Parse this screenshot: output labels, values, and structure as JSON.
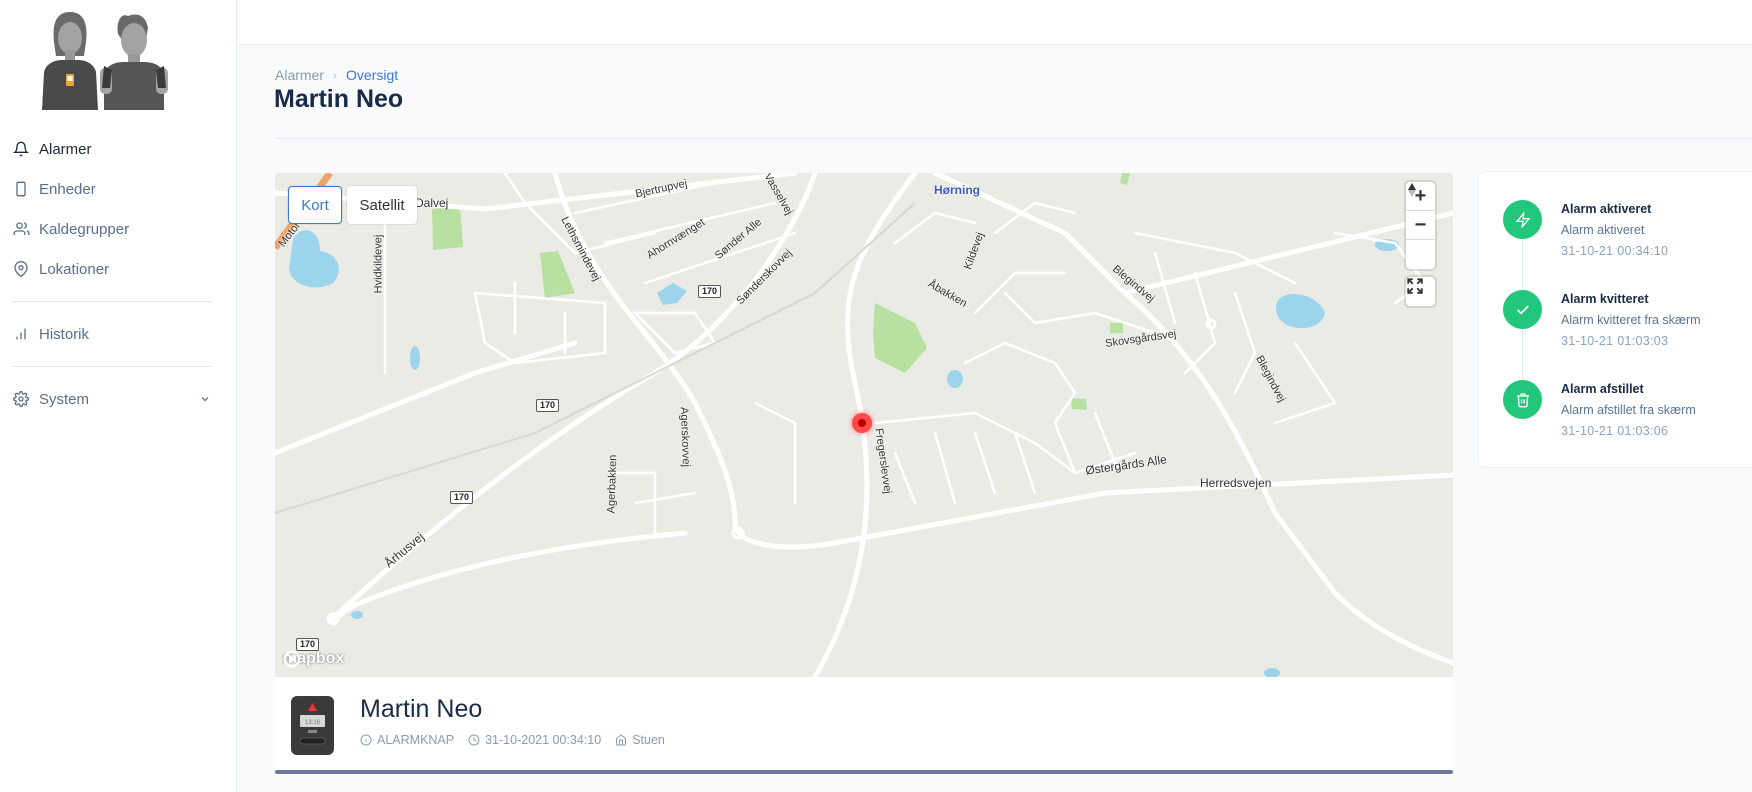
{
  "sidebar": {
    "items": [
      {
        "label": "Alarmer",
        "icon": "bell-icon"
      },
      {
        "label": "Enheder",
        "icon": "device-icon"
      },
      {
        "label": "Kaldegrupper",
        "icon": "users-icon"
      },
      {
        "label": "Lokationer",
        "icon": "location-pin-icon"
      },
      {
        "label": "Historik",
        "icon": "bar-chart-icon"
      },
      {
        "label": "System",
        "icon": "gear-icon"
      }
    ]
  },
  "breadcrumb": {
    "parent": "Alarmer",
    "current": "Oversigt"
  },
  "page": {
    "title": "Martin Neo"
  },
  "map": {
    "toggle_map": "Kort",
    "toggle_satellite": "Satellit",
    "active_view": "Kort",
    "zoom_in": "+",
    "zoom_out": "−",
    "attribution": "mapbox",
    "labels": {
      "horning": "Hørning",
      "dalvej": "Dalvej",
      "bjertrupvej": "Bjertrupvej",
      "motorvej": "Motorvej",
      "hvidkildevej": "Hvidkildevej",
      "lethsmindevej": "Lethsmindevej",
      "ahornvaenget": "Ahornvænget",
      "sonder_alle": "Sønder Alle",
      "sonderskovvej": "Sønderskovvej",
      "vasselvej": "Vasselvej",
      "kildevej": "Kildevej",
      "abakken": "Åbakken",
      "blegindvej": "Blegindvej",
      "skovsgaardsvej": "Skovsgårdsvej",
      "agerskovvej": "Agerskovvej",
      "fregerslevvej": "Fregerslevvej",
      "agerbakken": "Agerbakken",
      "ostergaards_alle": "Østergårds Alle",
      "herredsvejen": "Herredsvejen",
      "arhusvej": "Århusvej",
      "route_170": "170"
    }
  },
  "device": {
    "name": "Martin Neo",
    "type": "ALARMKNAP",
    "timestamp": "31-10-2021 00:34:10",
    "location": "Stuen",
    "screen_time": "13:16"
  },
  "timeline": [
    {
      "title": "Alarm aktiveret",
      "description": "Alarm aktiveret",
      "time": "31-10-21 00:34:10",
      "icon": "lightning-icon"
    },
    {
      "title": "Alarm kvitteret",
      "description": "Alarm kvitteret fra skærm",
      "time": "31-10-21 01:03:03",
      "icon": "check-icon"
    },
    {
      "title": "Alarm afstillet",
      "description": "Alarm afstillet fra skærm",
      "time": "31-10-21 01:03:06",
      "icon": "trash-icon"
    }
  ],
  "colors": {
    "accent": "#3d78d8",
    "success": "#22c77c",
    "pin": "#ff4a4a"
  }
}
